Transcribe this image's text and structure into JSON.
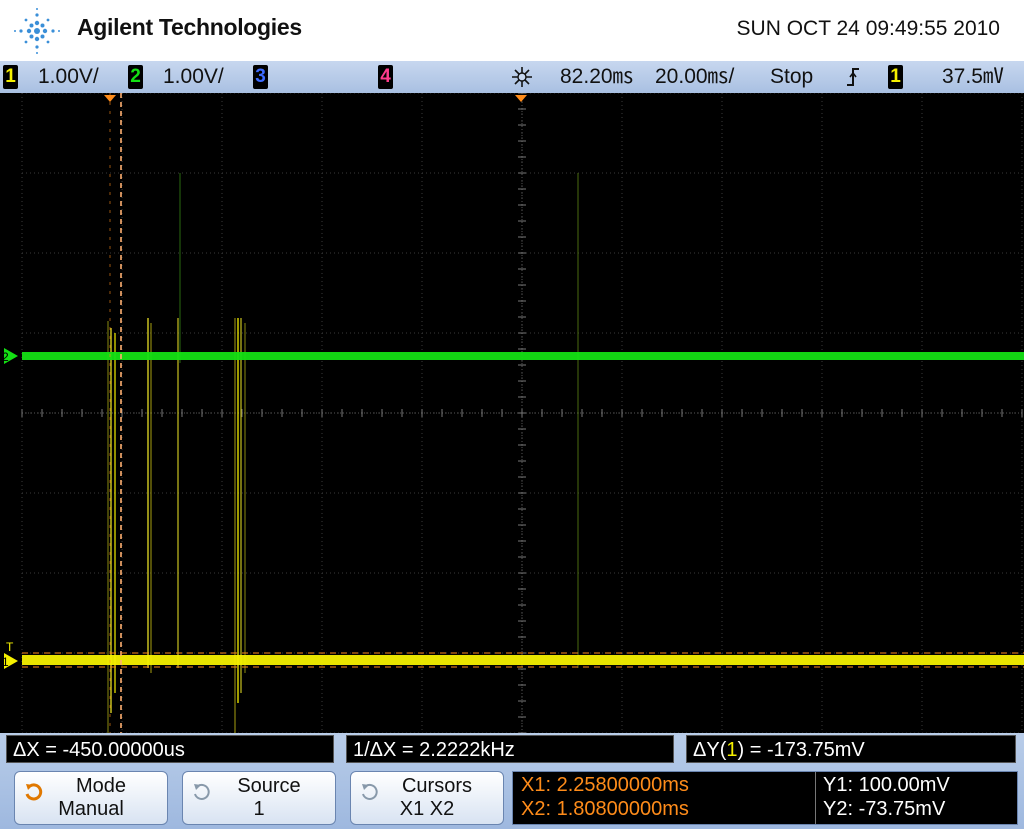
{
  "header": {
    "brand": "Agilent Technologies",
    "datetime": "SUN OCT 24 09:49:55 2010",
    "logo_icon": "agilent-spark-logo"
  },
  "status": {
    "ch1_num": "1",
    "ch1_scale": "1.00V/",
    "ch2_num": "2",
    "ch2_scale": "1.00V/",
    "ch3_num": "3",
    "ch4_num": "4",
    "delay": "82.20㎳",
    "timebase": "20.00㎳/",
    "run_state": "Stop",
    "trig_icon": "rising-edge-icon",
    "trig_src": "1",
    "trig_level": "37.5㎷"
  },
  "colors": {
    "ch1": "#f5f000",
    "ch2": "#14e014",
    "ch3": "#3d6bff",
    "ch4": "#ff3c8c",
    "cursor": "#ff8c1a"
  },
  "markers": {
    "ch2": "2",
    "ch1": "1",
    "trigger": "T"
  },
  "measurements": {
    "dx": "ΔX = -450.00000us",
    "inv_dx": "1/ΔX = 2.2222kHz",
    "dy_prefix": "ΔY(",
    "dy_ch": "1",
    "dy_suffix": ") = -173.75mV"
  },
  "softkeys": {
    "mode_label": "Mode",
    "mode_value": "Manual",
    "source_label": "Source",
    "source_value": "1",
    "cursors_label": "Cursors",
    "cursors_value": "X1 X2"
  },
  "cursor_readout": {
    "x1": "X1: 2.25800000ms",
    "x2": "X2: 1.80800000ms",
    "y1": "Y1: 100.00mV",
    "y2": "Y2: -73.75mV"
  }
}
